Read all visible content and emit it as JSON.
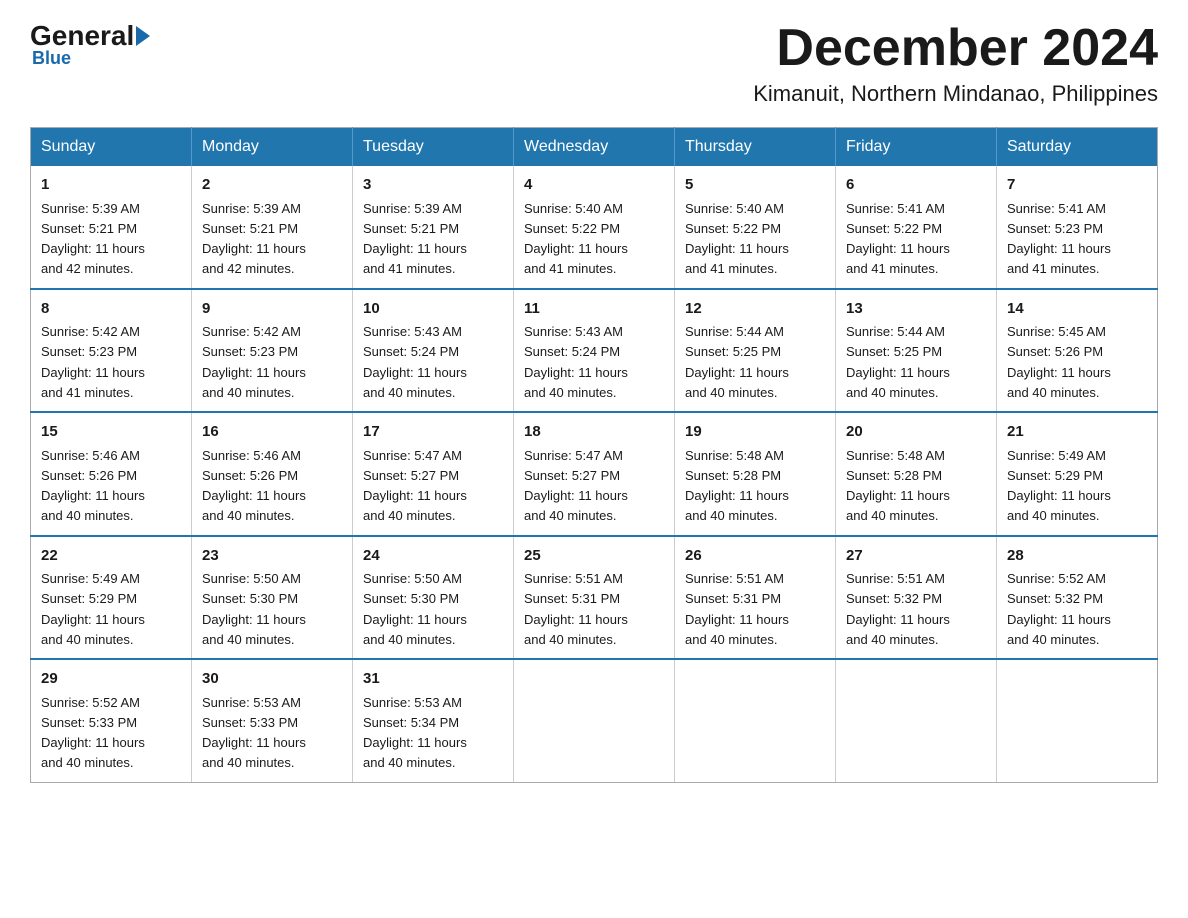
{
  "header": {
    "logo_general": "General",
    "logo_blue": "Blue",
    "month_title": "December 2024",
    "location": "Kimanuit, Northern Mindanao, Philippines"
  },
  "days_of_week": [
    "Sunday",
    "Monday",
    "Tuesday",
    "Wednesday",
    "Thursday",
    "Friday",
    "Saturday"
  ],
  "weeks": [
    [
      {
        "day": "1",
        "sunrise": "5:39 AM",
        "sunset": "5:21 PM",
        "daylight": "11 hours and 42 minutes."
      },
      {
        "day": "2",
        "sunrise": "5:39 AM",
        "sunset": "5:21 PM",
        "daylight": "11 hours and 42 minutes."
      },
      {
        "day": "3",
        "sunrise": "5:39 AM",
        "sunset": "5:21 PM",
        "daylight": "11 hours and 41 minutes."
      },
      {
        "day": "4",
        "sunrise": "5:40 AM",
        "sunset": "5:22 PM",
        "daylight": "11 hours and 41 minutes."
      },
      {
        "day": "5",
        "sunrise": "5:40 AM",
        "sunset": "5:22 PM",
        "daylight": "11 hours and 41 minutes."
      },
      {
        "day": "6",
        "sunrise": "5:41 AM",
        "sunset": "5:22 PM",
        "daylight": "11 hours and 41 minutes."
      },
      {
        "day": "7",
        "sunrise": "5:41 AM",
        "sunset": "5:23 PM",
        "daylight": "11 hours and 41 minutes."
      }
    ],
    [
      {
        "day": "8",
        "sunrise": "5:42 AM",
        "sunset": "5:23 PM",
        "daylight": "11 hours and 41 minutes."
      },
      {
        "day": "9",
        "sunrise": "5:42 AM",
        "sunset": "5:23 PM",
        "daylight": "11 hours and 40 minutes."
      },
      {
        "day": "10",
        "sunrise": "5:43 AM",
        "sunset": "5:24 PM",
        "daylight": "11 hours and 40 minutes."
      },
      {
        "day": "11",
        "sunrise": "5:43 AM",
        "sunset": "5:24 PM",
        "daylight": "11 hours and 40 minutes."
      },
      {
        "day": "12",
        "sunrise": "5:44 AM",
        "sunset": "5:25 PM",
        "daylight": "11 hours and 40 minutes."
      },
      {
        "day": "13",
        "sunrise": "5:44 AM",
        "sunset": "5:25 PM",
        "daylight": "11 hours and 40 minutes."
      },
      {
        "day": "14",
        "sunrise": "5:45 AM",
        "sunset": "5:26 PM",
        "daylight": "11 hours and 40 minutes."
      }
    ],
    [
      {
        "day": "15",
        "sunrise": "5:46 AM",
        "sunset": "5:26 PM",
        "daylight": "11 hours and 40 minutes."
      },
      {
        "day": "16",
        "sunrise": "5:46 AM",
        "sunset": "5:26 PM",
        "daylight": "11 hours and 40 minutes."
      },
      {
        "day": "17",
        "sunrise": "5:47 AM",
        "sunset": "5:27 PM",
        "daylight": "11 hours and 40 minutes."
      },
      {
        "day": "18",
        "sunrise": "5:47 AM",
        "sunset": "5:27 PM",
        "daylight": "11 hours and 40 minutes."
      },
      {
        "day": "19",
        "sunrise": "5:48 AM",
        "sunset": "5:28 PM",
        "daylight": "11 hours and 40 minutes."
      },
      {
        "day": "20",
        "sunrise": "5:48 AM",
        "sunset": "5:28 PM",
        "daylight": "11 hours and 40 minutes."
      },
      {
        "day": "21",
        "sunrise": "5:49 AM",
        "sunset": "5:29 PM",
        "daylight": "11 hours and 40 minutes."
      }
    ],
    [
      {
        "day": "22",
        "sunrise": "5:49 AM",
        "sunset": "5:29 PM",
        "daylight": "11 hours and 40 minutes."
      },
      {
        "day": "23",
        "sunrise": "5:50 AM",
        "sunset": "5:30 PM",
        "daylight": "11 hours and 40 minutes."
      },
      {
        "day": "24",
        "sunrise": "5:50 AM",
        "sunset": "5:30 PM",
        "daylight": "11 hours and 40 minutes."
      },
      {
        "day": "25",
        "sunrise": "5:51 AM",
        "sunset": "5:31 PM",
        "daylight": "11 hours and 40 minutes."
      },
      {
        "day": "26",
        "sunrise": "5:51 AM",
        "sunset": "5:31 PM",
        "daylight": "11 hours and 40 minutes."
      },
      {
        "day": "27",
        "sunrise": "5:51 AM",
        "sunset": "5:32 PM",
        "daylight": "11 hours and 40 minutes."
      },
      {
        "day": "28",
        "sunrise": "5:52 AM",
        "sunset": "5:32 PM",
        "daylight": "11 hours and 40 minutes."
      }
    ],
    [
      {
        "day": "29",
        "sunrise": "5:52 AM",
        "sunset": "5:33 PM",
        "daylight": "11 hours and 40 minutes."
      },
      {
        "day": "30",
        "sunrise": "5:53 AM",
        "sunset": "5:33 PM",
        "daylight": "11 hours and 40 minutes."
      },
      {
        "day": "31",
        "sunrise": "5:53 AM",
        "sunset": "5:34 PM",
        "daylight": "11 hours and 40 minutes."
      },
      null,
      null,
      null,
      null
    ]
  ],
  "labels": {
    "sunrise": "Sunrise:",
    "sunset": "Sunset:",
    "daylight": "Daylight:"
  }
}
